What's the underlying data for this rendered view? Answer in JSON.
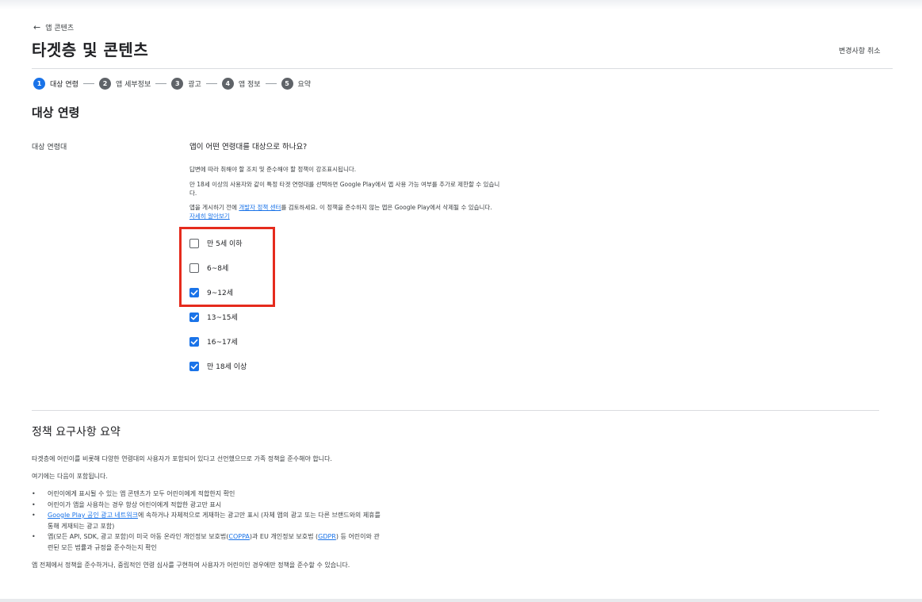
{
  "header": {
    "back_label": "앱 콘텐츠",
    "title": "타겟층 및 콘텐츠",
    "discard_label": "변경사항 취소"
  },
  "stepper": [
    {
      "num": "1",
      "label": "대상 연령",
      "active": true
    },
    {
      "num": "2",
      "label": "앱 세부정보",
      "active": false
    },
    {
      "num": "3",
      "label": "광고",
      "active": false
    },
    {
      "num": "4",
      "label": "앱 정보",
      "active": false
    },
    {
      "num": "5",
      "label": "요약",
      "active": false
    }
  ],
  "section": {
    "title": "대상 연령",
    "field_label": "대상 연령대",
    "question": "앱이 어떤 연령대를 대상으로 하나요?",
    "desc1": "답변에 따라 취해야 할 조치 및 준수해야 할 정책이 강조표시됩니다.",
    "desc2": "만 18세 이상의 사용자와 같이 특정 타겟 연령대를 선택하면 Google Play에서 앱 사용 가능 여부를 추가로 제한할 수 있습니다.",
    "desc3_before": "앱을 게시하기 전에 ",
    "desc3_link": "개발자 정책 센터",
    "desc3_after": "를 검토하세요. 이 정책을 준수하지 않는 앱은 Google Play에서 삭제될 수 있습니다.",
    "learn_more": "자세히 알아보기"
  },
  "age_options": [
    {
      "label": "만 5세 이하",
      "checked": false
    },
    {
      "label": "6~8세",
      "checked": false
    },
    {
      "label": "9~12세",
      "checked": true
    },
    {
      "label": "13~15세",
      "checked": true
    },
    {
      "label": "16~17세",
      "checked": true
    },
    {
      "label": "만 18세 이상",
      "checked": true
    }
  ],
  "policy": {
    "title": "정책 요구사항 요약",
    "intro": "타겟층에 어린이를 비롯해 다양한 연령대의 사용자가 포함되어 있다고 선언했으므로 가족 정책을 준수해야 합니다.",
    "includes": "여기에는 다음이 포함됩니다.",
    "item1": "어린이에게 표시될 수 있는 앱 콘텐츠가 모두 어린이에게 적합한지 확인",
    "item2": "어린이가 앱을 사용하는 경우 항상 어린이에게 적합한 광고만 표시",
    "item3_link": "Google Play 공인 광고 네트워크",
    "item3_rest": "에 속하거나 자체적으로 게재하는 광고만 표시 (자체 앱의 광고 또는 다른 브랜드와의 제휴를 통해 게재되는 광고 포함)",
    "item4_a": "앱(모든 API, SDK, 광고 포함)이 미국 아동 온라인 개인정보 보호법(",
    "item4_link1": "COPPA",
    "item4_b": ")과 EU 개인정보 보호법 (",
    "item4_link2": "GDPR",
    "item4_c": ") 등 어린이와 관련된 모든 법률과 규정을 준수하는지 확인",
    "outro": "앱 전체에서 정책을 준수하거나, 중립적인 연령 심사를 구현하여 사용자가 어린이인 경우에만 정책을 준수할 수 있습니다.",
    "bullet": "•"
  },
  "colors": {
    "accent": "#1a73e8",
    "highlight": "#e52b1d"
  }
}
